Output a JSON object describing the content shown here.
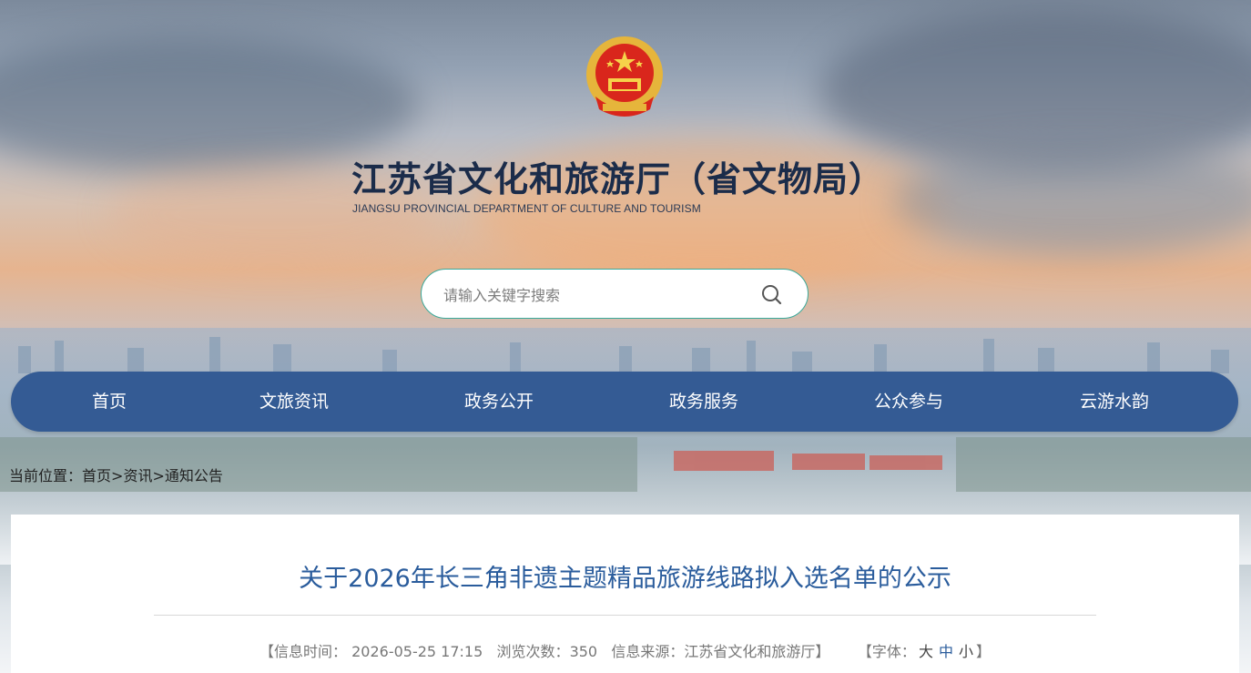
{
  "header": {
    "title": "江苏省文化和旅游厅（省文物局）",
    "subtitle": "JIANGSU PROVINCIAL DEPARTMENT OF CULTURE AND TOURISM",
    "emblem_icon": "national-emblem-icon"
  },
  "search": {
    "placeholder": "请输入关键字搜索",
    "value": "",
    "icon": "search-icon",
    "border_color": "#3aa99a"
  },
  "nav": {
    "background": "#345b94",
    "items": [
      {
        "label": "首页"
      },
      {
        "label": "文旅资讯"
      },
      {
        "label": "政务公开"
      },
      {
        "label": "政务服务"
      },
      {
        "label": "公众参与"
      },
      {
        "label": "云游水韵"
      }
    ]
  },
  "breadcrumb": {
    "prefix": "当前位置：",
    "items": [
      "首页",
      "资讯",
      "通知公告"
    ],
    "separator": ">"
  },
  "article": {
    "title": "关于2026年长三角非遗主题精品旅游线路拟入选名单的公示",
    "title_color": "#2a5c9c",
    "meta": {
      "time_label": "【信息时间：",
      "time_value": "2026-05-25 17:15",
      "views_label": "浏览次数：",
      "views_value": "350",
      "source_label": "信息来源：",
      "source_value": "江苏省文化和旅游厅】",
      "font_label": "【字体：",
      "font_options": [
        "大",
        "中",
        "小"
      ],
      "font_close": "】"
    }
  }
}
